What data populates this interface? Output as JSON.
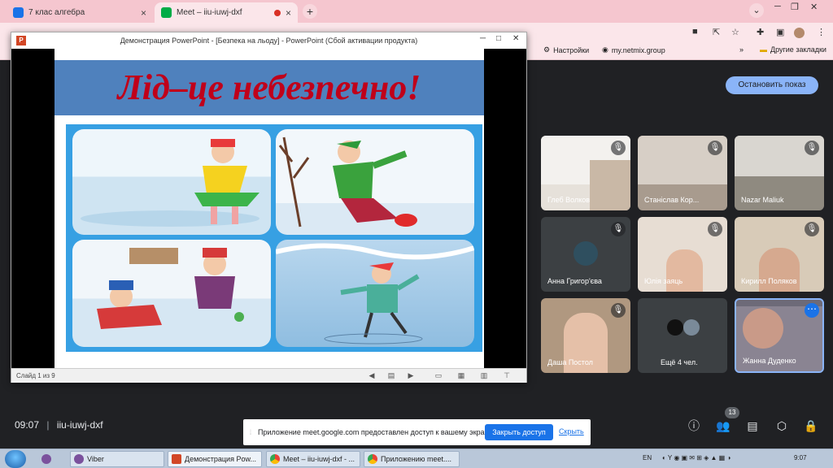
{
  "browser": {
    "tabs": [
      {
        "label": "7 клас алгебра",
        "icon": "classroom-icon",
        "active": false
      },
      {
        "label": "Meet – iiu-iuwj-dxf",
        "icon": "meet-icon",
        "active": true
      }
    ],
    "new_tab": "+",
    "bookmarks": [
      {
        "label": "Настройки",
        "icon": "gear-icon"
      },
      {
        "label": "my.netmix.group",
        "icon": "globe-icon"
      },
      {
        "label": "Другие закладки",
        "icon": "folder-icon"
      }
    ],
    "bookmarks_overflow": "»"
  },
  "powerpoint": {
    "window_title": "Демонстрация PowerPoint - [Безпека на льоду] - PowerPoint (Сбой активации продукта)",
    "slide_title": "Лід–це небезпечно!",
    "slide_info": "Слайд 1 из 9",
    "accent": "#4f81bd",
    "title_color": "#c0001a"
  },
  "meet": {
    "stop_presenting": "Остановить показ",
    "meeting_time": "09:07",
    "meeting_code": "iiu-iuwj-dxf",
    "people_count": "13",
    "participants": [
      {
        "name": "Глеб Волков",
        "muted": true
      },
      {
        "name": "Станіслав Кор...",
        "muted": true
      },
      {
        "name": "Nazar Maliuk",
        "muted": true
      },
      {
        "name": "Анна Григор'єва",
        "muted": true
      },
      {
        "name": "Юлія заяць",
        "muted": true
      },
      {
        "name": "Кирилл Поляков",
        "muted": true
      },
      {
        "name": "Даша Постол",
        "muted": true
      },
      {
        "name": "Ещё 4 чел.",
        "muted": false
      },
      {
        "name": "Жанна Дуденко",
        "muted": false
      }
    ]
  },
  "share_notification": {
    "message": "Приложение meet.google.com предоставлен доступ к вашему экрану.",
    "primary": "Закрыть доступ",
    "secondary": "Скрыть"
  },
  "taskbar": {
    "tasks": [
      {
        "label": "Viber",
        "icon": "viber-icon"
      },
      {
        "label": "Демонстрация Pow...",
        "icon": "powerpoint-icon"
      },
      {
        "label": "Meet – iiu-iuwj-dxf - ...",
        "icon": "chrome-icon"
      },
      {
        "label": "Приложению meet....",
        "icon": "chrome-icon"
      }
    ],
    "language": "EN",
    "clock": "9:07"
  }
}
